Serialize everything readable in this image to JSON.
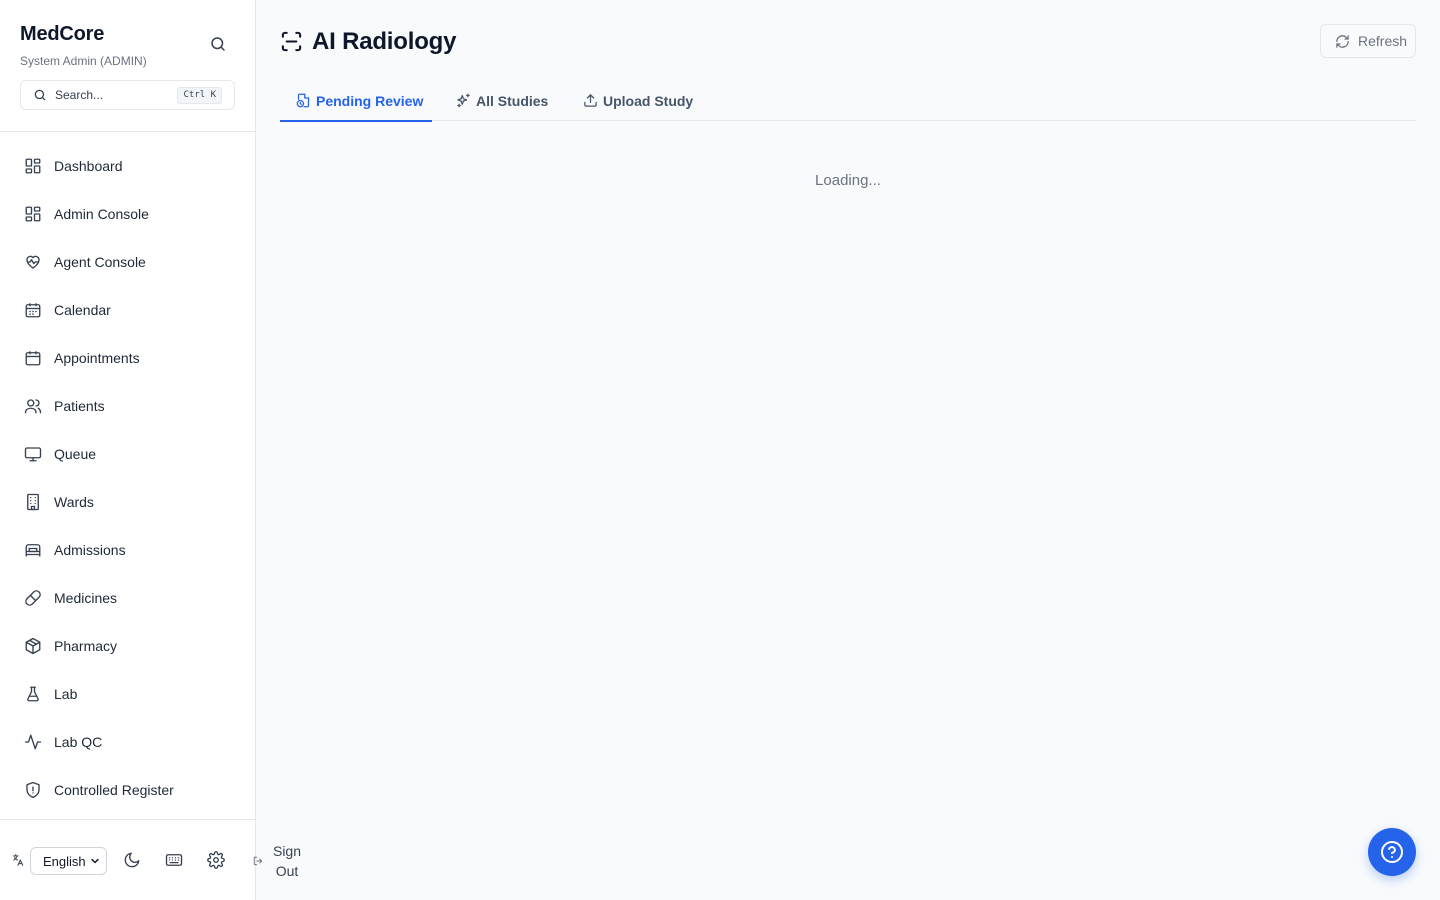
{
  "sidebar": {
    "brand": "MedCore",
    "role": "System Admin (ADMIN)",
    "search": {
      "placeholder": "Search...",
      "shortcut": "Ctrl K"
    },
    "items": [
      {
        "label": "Dashboard",
        "icon": "layout-grid-icon"
      },
      {
        "label": "Admin Console",
        "icon": "layout-grid-icon"
      },
      {
        "label": "Agent Console",
        "icon": "heart-pulse-icon"
      },
      {
        "label": "Calendar",
        "icon": "calendar-days-icon"
      },
      {
        "label": "Appointments",
        "icon": "calendar-icon"
      },
      {
        "label": "Patients",
        "icon": "users-icon"
      },
      {
        "label": "Queue",
        "icon": "monitor-icon"
      },
      {
        "label": "Wards",
        "icon": "building-icon"
      },
      {
        "label": "Admissions",
        "icon": "bed-icon"
      },
      {
        "label": "Medicines",
        "icon": "pill-icon"
      },
      {
        "label": "Pharmacy",
        "icon": "package-icon"
      },
      {
        "label": "Lab",
        "icon": "flask-icon"
      },
      {
        "label": "Lab QC",
        "icon": "activity-icon"
      },
      {
        "label": "Controlled Register",
        "icon": "shield-icon"
      }
    ],
    "footer": {
      "language": "English",
      "sign_out": "Sign Out"
    }
  },
  "header": {
    "title": "AI Radiology",
    "refresh_label": "Refresh"
  },
  "tabs": [
    {
      "label": "Pending Review",
      "active": true
    },
    {
      "label": "All Studies",
      "active": false
    },
    {
      "label": "Upload Study",
      "active": false
    }
  ],
  "status": {
    "loading": "Loading..."
  },
  "colors": {
    "accent": "#2563eb",
    "background": "#f8fafc",
    "sidebar": "#ffffff"
  }
}
